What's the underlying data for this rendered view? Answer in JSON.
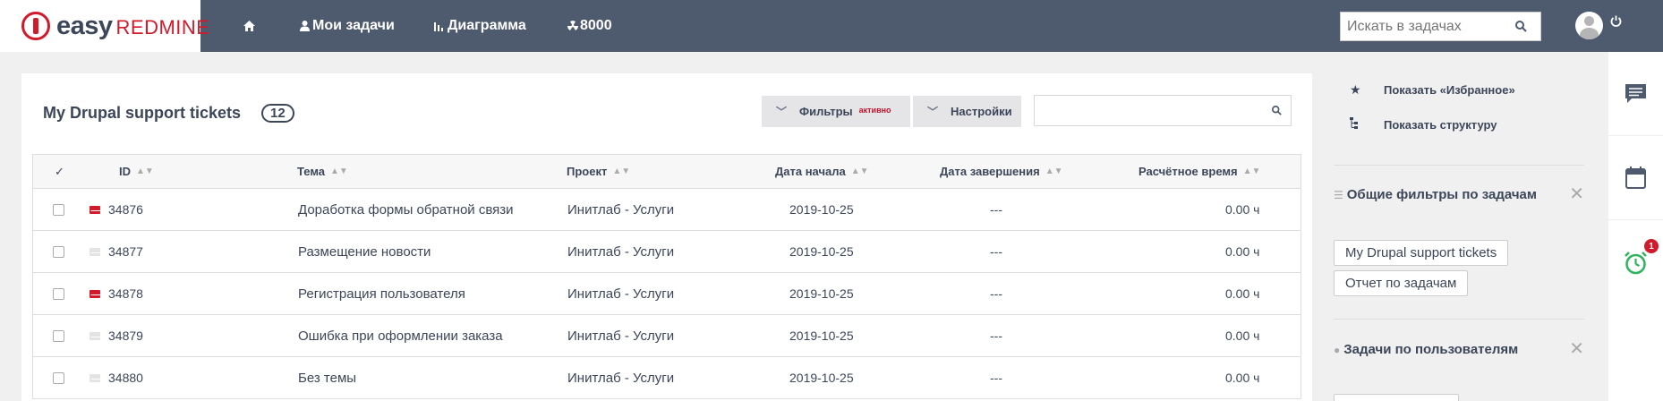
{
  "header": {
    "logo_word1": "easy",
    "logo_word2": "REDMINE",
    "nav_home_icon": "home-icon",
    "nav_mytasks_label": "Мои задачи",
    "nav_chart_label": "Диаграмма",
    "nav_count_label": "8000",
    "search_placeholder": "Искать в задачах"
  },
  "main": {
    "title": "My Drupal support tickets",
    "count": "12",
    "filters_label": "Фильтры",
    "filters_active": "активно",
    "settings_label": "Настройки",
    "table": {
      "headers": {
        "check": "✓",
        "id": "ID",
        "subject": "Тема",
        "project": "Проект",
        "start": "Дата начала",
        "due": "Дата завершения",
        "estimated": "Расчётное время"
      },
      "rows": [
        {
          "mail": "red",
          "id": "34876",
          "subject": "Доработка формы обратной связи",
          "project": "Инитлаб - Услуги",
          "start": "2019-10-25",
          "due": "---",
          "estimated": "0.00 ч"
        },
        {
          "mail": "grey",
          "id": "34877",
          "subject": "Размещение новости",
          "project": "Инитлаб - Услуги",
          "start": "2019-10-25",
          "due": "---",
          "estimated": "0.00 ч"
        },
        {
          "mail": "red",
          "id": "34878",
          "subject": "Регистрация пользователя",
          "project": "Инитлаб - Услуги",
          "start": "2019-10-25",
          "due": "---",
          "estimated": "0.00 ч"
        },
        {
          "mail": "grey",
          "id": "34879",
          "subject": "Ошибка при оформлении заказа",
          "project": "Инитлаб - Услуги",
          "start": "2019-10-25",
          "due": "---",
          "estimated": "0.00 ч"
        },
        {
          "mail": "grey",
          "id": "34880",
          "subject": "Без темы",
          "project": "Инитлаб - Услуги",
          "start": "2019-10-25",
          "due": "---",
          "estimated": "0.00 ч"
        }
      ]
    }
  },
  "sidebar": {
    "show_favorites": "Показать «Избранное»",
    "show_structure": "Показать структуру",
    "common_filters_title": "Общие фильтры по задачам",
    "filter_pills": [
      "My Drupal support tickets",
      "Отчет по задачам"
    ],
    "tasks_by_users_title": "Задачи по пользователям"
  },
  "rightbar": {
    "icons": [
      "comment-icon",
      "calendar-icon",
      "alarm-clock-icon"
    ],
    "alarm_badge": "1"
  },
  "colors": {
    "topbar": "#4e5a6e",
    "accent_red": "#d11a2a",
    "alarm_green": "#2db35d"
  }
}
